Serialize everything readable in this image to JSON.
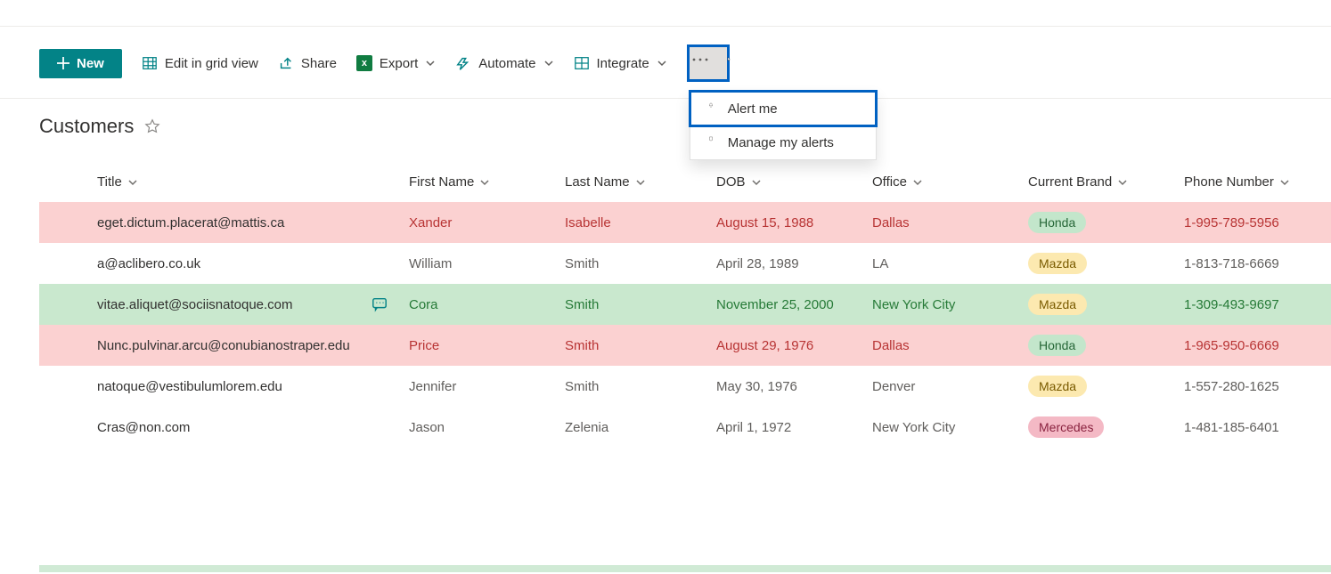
{
  "toolbar": {
    "new_label": "New",
    "edit_grid": "Edit in grid view",
    "share": "Share",
    "export": "Export",
    "automate": "Automate",
    "integrate": "Integrate"
  },
  "menu": {
    "alert_me": "Alert me",
    "manage_alerts": "Manage my alerts"
  },
  "list": {
    "title": "Customers"
  },
  "columns": {
    "title": "Title",
    "first_name": "First Name",
    "last_name": "Last Name",
    "dob": "DOB",
    "office": "Office",
    "brand": "Current Brand",
    "phone": "Phone Number"
  },
  "rows": [
    {
      "style": "pink",
      "title": "eget.dictum.placerat@mattis.ca",
      "first": "Xander",
      "last": "Isabelle",
      "dob": "August 15, 1988",
      "office": "Dallas",
      "brand": "Honda",
      "brand_class": "honda",
      "phone": "1-995-789-5956",
      "has_comment": false
    },
    {
      "style": "plain",
      "title": "a@aclibero.co.uk",
      "first": "William",
      "last": "Smith",
      "dob": "April 28, 1989",
      "office": "LA",
      "brand": "Mazda",
      "brand_class": "mazda",
      "phone": "1-813-718-6669",
      "has_comment": false
    },
    {
      "style": "green",
      "title": "vitae.aliquet@sociisnatoque.com",
      "first": "Cora",
      "last": "Smith",
      "dob": "November 25, 2000",
      "office": "New York City",
      "brand": "Mazda",
      "brand_class": "mazda",
      "phone": "1-309-493-9697",
      "has_comment": true
    },
    {
      "style": "pink",
      "title": "Nunc.pulvinar.arcu@conubianostraper.edu",
      "first": "Price",
      "last": "Smith",
      "dob": "August 29, 1976",
      "office": "Dallas",
      "brand": "Honda",
      "brand_class": "honda",
      "phone": "1-965-950-6669",
      "has_comment": false
    },
    {
      "style": "plain",
      "title": "natoque@vestibulumlorem.edu",
      "first": "Jennifer",
      "last": "Smith",
      "dob": "May 30, 1976",
      "office": "Denver",
      "brand": "Mazda",
      "brand_class": "mazda",
      "phone": "1-557-280-1625",
      "has_comment": false
    },
    {
      "style": "plain",
      "title": "Cras@non.com",
      "first": "Jason",
      "last": "Zelenia",
      "dob": "April 1, 1972",
      "office": "New York City",
      "brand": "Mercedes",
      "brand_class": "mercedes",
      "phone": "1-481-185-6401",
      "has_comment": false
    }
  ]
}
